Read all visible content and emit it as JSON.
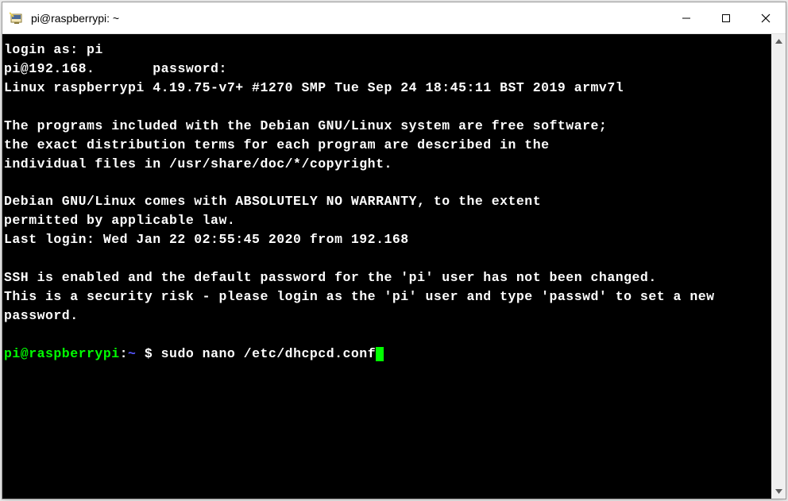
{
  "titlebar": {
    "title": "pi@raspberrypi: ~"
  },
  "terminal": {
    "line1": "login as: pi",
    "line2a": "pi@192.168.",
    "line2b": "       password:",
    "line3": "Linux raspberrypi 4.19.75-v7+ #1270 SMP Tue Sep 24 18:45:11 BST 2019 armv7l",
    "line4": "",
    "line5": "The programs included with the Debian GNU/Linux system are free software;",
    "line6": "the exact distribution terms for each program are described in the",
    "line7": "individual files in /usr/share/doc/*/copyright.",
    "line8": "",
    "line9": "Debian GNU/Linux comes with ABSOLUTELY NO WARRANTY, to the extent",
    "line10": "permitted by applicable law.",
    "line11": "Last login: Wed Jan 22 02:55:45 2020 from 192.168",
    "line12": "",
    "line13": "SSH is enabled and the default password for the 'pi' user has not been changed.",
    "line14": "This is a security risk - please login as the 'pi' user and type 'passwd' to set a new password.",
    "line15": "",
    "prompt": {
      "userhost": "pi@raspberrypi",
      "colon": ":",
      "path": "~",
      "dollar": " $ ",
      "command": "sudo nano /etc/dhcpcd.conf"
    }
  }
}
